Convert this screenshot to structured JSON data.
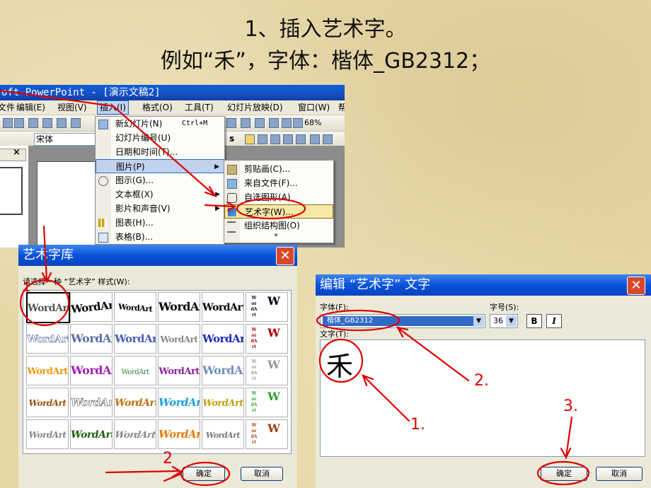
{
  "slide_title": {
    "line1": "1、插入艺术字。",
    "line2": "例如“禾”，字体：楷体_GB2312；"
  },
  "powerpoint": {
    "title": "oft PowerPoint - [演示文稿2]",
    "menu": [
      "文件",
      "编辑(E)",
      "视图(V)",
      "插入(I)",
      "格式(O)",
      "工具(T)",
      "幻灯片放映(D)",
      "窗口(W)",
      "帮"
    ],
    "font_box": "宋体",
    "zoom": "68%",
    "close_glyph": "×"
  },
  "insert_menu": {
    "items": [
      {
        "label": "新幻灯片(N)",
        "shortcut": "Ctrl+M",
        "icon": "new-slide-icon"
      },
      {
        "label": "幻灯片编号(U)",
        "icon": ""
      },
      {
        "label": "日期和时间(T)...",
        "icon": ""
      },
      {
        "label": "图片(P)",
        "arrow": "▶",
        "icon": ""
      },
      {
        "label": "图示(G)...",
        "icon": "diagram-icon"
      },
      {
        "label": "文本框(X)",
        "arrow": "▶",
        "icon": ""
      },
      {
        "label": "影片和声音(V)",
        "arrow": "▶",
        "icon": ""
      },
      {
        "label": "图表(H)...",
        "icon": "chart-icon"
      },
      {
        "label": "表格(B)...",
        "icon": "table-icon"
      }
    ]
  },
  "picture_submenu": {
    "items": [
      {
        "label": "剪贴画(C)...",
        "icon": "clipart-icon"
      },
      {
        "label": "来自文件(F)...",
        "icon": "picture-file-icon"
      },
      {
        "label": "自选图形(A)",
        "icon": "autoshape-icon"
      },
      {
        "label": "艺术字(W)...",
        "icon": "wordart-icon"
      },
      {
        "label": "组织结构图(O)",
        "icon": "org-chart-icon"
      }
    ],
    "more": "»"
  },
  "gallery_dialog": {
    "title": "艺术字库",
    "prompt": "请选择一种 “艺术字” 样式(W):",
    "sample": "WordArt",
    "ok": "确定",
    "cancel": "取消",
    "close": "✕"
  },
  "edit_dialog": {
    "title": "编辑 “艺术字” 文字",
    "font_label": "字体(F):",
    "font_value": "楷体_GB2312",
    "size_label": "字号(S):",
    "size_value": "36",
    "bold": "B",
    "italic": "I",
    "text_label": "文字(T):",
    "text_value": "禾",
    "ok": "确定",
    "cancel": "取消",
    "close": "✕",
    "dropdown_arrow": "▼"
  },
  "annotations": [
    "1",
    "2",
    "2.",
    "1.",
    "3."
  ],
  "colors": {
    "annotation": "#e00000",
    "xp_title": "#0a52d8",
    "background": "#e6d7a6"
  }
}
